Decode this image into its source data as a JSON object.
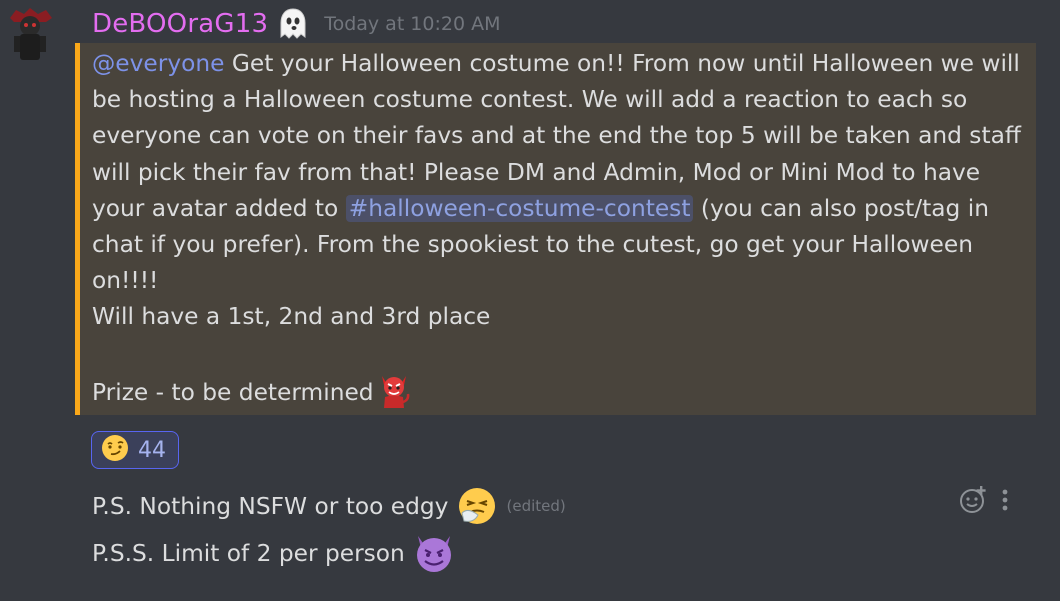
{
  "author": {
    "username": "DeBOOraG13",
    "badge_icon": "ghost-emoji-icon",
    "timestamp": "Today at 10:20 AM",
    "avatar_icon": "avatar-image"
  },
  "message": {
    "mention": "@everyone",
    "p1": " Get your Halloween costume on!! From now until Halloween we will be hosting a Halloween costume contest. We will add a reaction to each so everyone can vote on their favs and at the end the top 5 will be taken and staff will pick their fav from that! Please DM and Admin, Mod or Mini Mod to have your avatar added to ",
    "channel": "#halloween-costume-contest",
    "p1_end": " (you can also post/tag in chat if you prefer). From the spookiest to the cutest, go get your Halloween on!!!!",
    "p2": "Will have a 1st, 2nd and 3rd place",
    "p3": "Prize - to be determined",
    "p3_emoji": "red-devil-emoji-icon",
    "highlight_color": "#faa81a"
  },
  "reaction": {
    "emoji": "smirk-emoji-icon",
    "count": "44"
  },
  "followups": [
    {
      "text": "P.S. Nothing NSFW or too edgy",
      "emoji": "sneezing-face-emoji-icon",
      "edited": "(edited)"
    },
    {
      "text": "P.S.S. Limit of 2 per person",
      "emoji": "smiling-imp-emoji-icon"
    }
  ],
  "hover_actions": {
    "add_reaction_icon": "add-reaction-icon",
    "more_icon": "more-options-icon"
  },
  "colors": {
    "background": "#36393f",
    "username": "#e36df0",
    "mention": "#7d92e8",
    "highlight_bg": "#49443c"
  }
}
